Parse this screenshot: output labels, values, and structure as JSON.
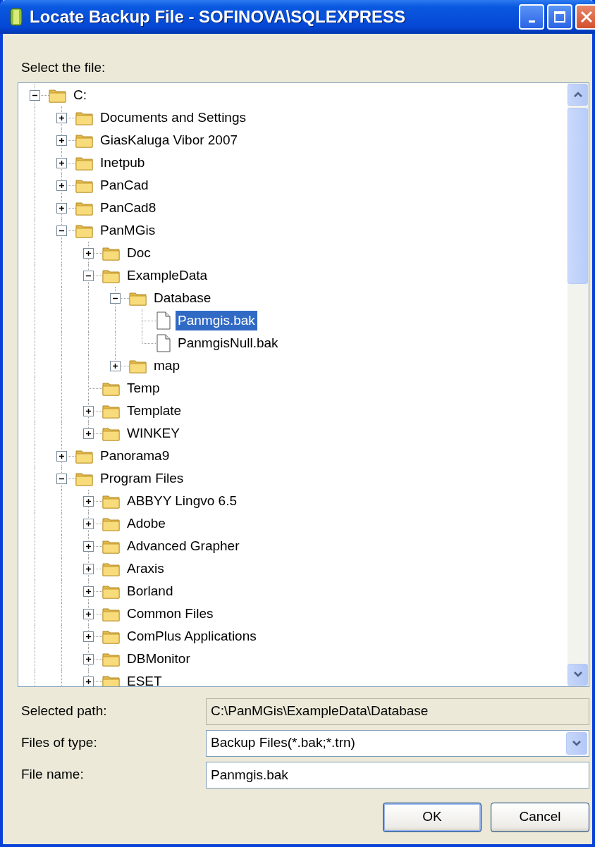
{
  "window": {
    "title": "Locate Backup File - SOFINOVA\\SQLEXPRESS"
  },
  "tree_label": "Select the file:",
  "tree": [
    {
      "label": "C:",
      "kind": "folder",
      "selected": false,
      "expanded": true,
      "children": [
        {
          "label": "Documents and Settings",
          "kind": "folder",
          "selected": false,
          "expanded": false
        },
        {
          "label": "GiasKaluga Vibor 2007",
          "kind": "folder",
          "selected": false,
          "expanded": false
        },
        {
          "label": "Inetpub",
          "kind": "folder",
          "selected": false,
          "expanded": false
        },
        {
          "label": "PanCad",
          "kind": "folder",
          "selected": false,
          "expanded": false
        },
        {
          "label": "PanCad8",
          "kind": "folder",
          "selected": false,
          "expanded": false
        },
        {
          "label": "PanMGis",
          "kind": "folder",
          "selected": false,
          "expanded": true,
          "children": [
            {
              "label": "Doc",
              "kind": "folder",
              "selected": false,
              "expanded": false
            },
            {
              "label": "ExampleData",
              "kind": "folder",
              "selected": false,
              "expanded": true,
              "children": [
                {
                  "label": "Database",
                  "kind": "folder",
                  "selected": false,
                  "expanded": true,
                  "children": [
                    {
                      "label": "Panmgis.bak",
                      "kind": "file",
                      "selected": true
                    },
                    {
                      "label": "PanmgisNull.bak",
                      "kind": "file",
                      "selected": false
                    }
                  ]
                },
                {
                  "label": "map",
                  "kind": "folder",
                  "selected": false,
                  "expanded": false
                }
              ]
            },
            {
              "label": "Temp",
              "kind": "folder",
              "selected": false
            },
            {
              "label": "Template",
              "kind": "folder",
              "selected": false,
              "expanded": false
            },
            {
              "label": "WINKEY",
              "kind": "folder",
              "selected": false,
              "expanded": false
            }
          ]
        },
        {
          "label": "Panorama9",
          "kind": "folder",
          "selected": false,
          "expanded": false
        },
        {
          "label": "Program Files",
          "kind": "folder",
          "selected": false,
          "expanded": true,
          "children": [
            {
              "label": "ABBYY Lingvo 6.5",
              "kind": "folder",
              "selected": false,
              "expanded": false
            },
            {
              "label": "Adobe",
              "kind": "folder",
              "selected": false,
              "expanded": false
            },
            {
              "label": "Advanced Grapher",
              "kind": "folder",
              "selected": false,
              "expanded": false
            },
            {
              "label": "Araxis",
              "kind": "folder",
              "selected": false,
              "expanded": false
            },
            {
              "label": "Borland",
              "kind": "folder",
              "selected": false,
              "expanded": false
            },
            {
              "label": "Common Files",
              "kind": "folder",
              "selected": false,
              "expanded": false
            },
            {
              "label": "ComPlus Applications",
              "kind": "folder",
              "selected": false,
              "expanded": false
            },
            {
              "label": "DBMonitor",
              "kind": "folder",
              "selected": false,
              "expanded": false
            },
            {
              "label": "ESET",
              "kind": "folder",
              "selected": false,
              "expanded": false
            }
          ]
        }
      ]
    }
  ],
  "fields": [
    {
      "label": "Selected path:",
      "kind": "readonly",
      "value": "C:\\PanMGis\\ExampleData\\Database"
    },
    {
      "label": "Files of type:",
      "kind": "dropdown",
      "value": "Backup Files(*.bak;*.trn)"
    },
    {
      "label": "File name:",
      "kind": "text",
      "value": "Panmgis.bak"
    }
  ],
  "buttons": [
    {
      "label": "OK",
      "default": true
    },
    {
      "label": "Cancel",
      "default": false
    }
  ]
}
